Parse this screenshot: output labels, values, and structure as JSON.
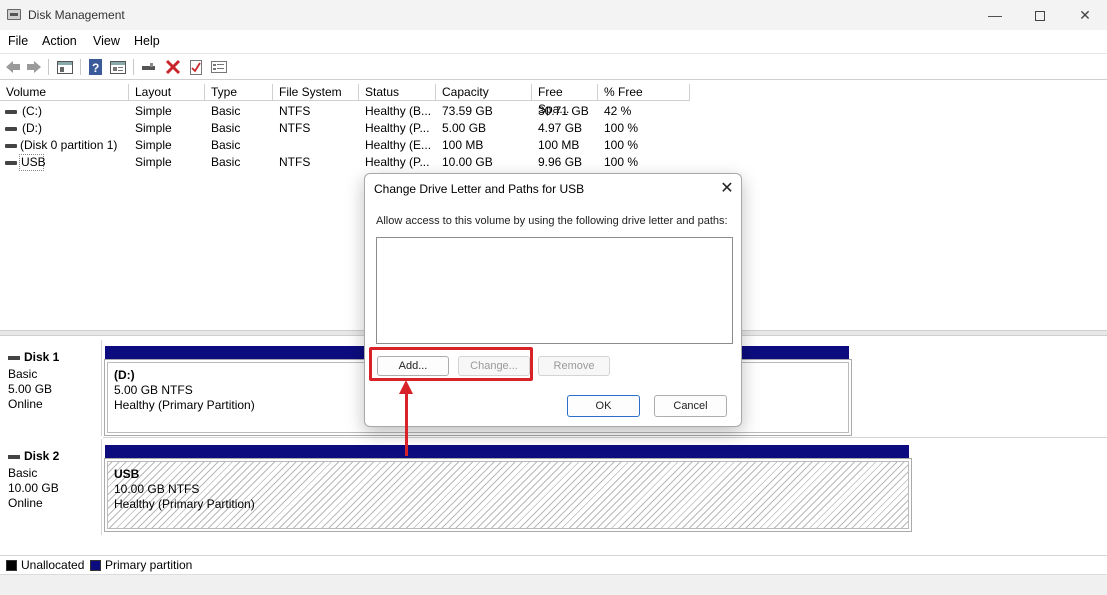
{
  "window": {
    "title": "Disk Management",
    "minimize_glyph": "—",
    "close_glyph": "✕"
  },
  "menu": [
    "File",
    "Action",
    "View",
    "Help"
  ],
  "toolbar_icons": [
    "back-icon",
    "forward-icon",
    "console-tree-icon",
    "help-icon",
    "properties-icon",
    "connect-icon",
    "delete-icon",
    "check-icon",
    "list-icon"
  ],
  "volume_table": {
    "columns": [
      "Volume",
      "Layout",
      "Type",
      "File System",
      "Status",
      "Capacity",
      "Free Spa...",
      "% Free"
    ],
    "rows": [
      {
        "volume": "(C:)",
        "layout": "Simple",
        "type": "Basic",
        "fs": "NTFS",
        "status": "Healthy (B...",
        "capacity": "73.59 GB",
        "free": "30.71 GB",
        "pct": "42 %"
      },
      {
        "volume": "(D:)",
        "layout": "Simple",
        "type": "Basic",
        "fs": "NTFS",
        "status": "Healthy (P...",
        "capacity": "5.00 GB",
        "free": "4.97 GB",
        "pct": "100 %"
      },
      {
        "volume": "(Disk 0 partition 1)",
        "layout": "Simple",
        "type": "Basic",
        "fs": "",
        "status": "Healthy (E...",
        "capacity": "100 MB",
        "free": "100 MB",
        "pct": "100 %"
      },
      {
        "volume": "USB",
        "layout": "Simple",
        "type": "Basic",
        "fs": "NTFS",
        "status": "Healthy (P...",
        "capacity": "10.00 GB",
        "free": "9.96 GB",
        "pct": "100 %"
      }
    ]
  },
  "disks": [
    {
      "name": "Disk 1",
      "type": "Basic",
      "size": "5.00 GB",
      "state": "Online",
      "partition": {
        "label": "(D:)",
        "size_fs": "5.00 GB NTFS",
        "status": "Healthy (Primary Partition)"
      }
    },
    {
      "name": "Disk 2",
      "type": "Basic",
      "size": "10.00 GB",
      "state": "Online",
      "partition": {
        "label": "USB",
        "size_fs": "10.00 GB NTFS",
        "status": "Healthy (Primary Partition)"
      }
    }
  ],
  "legend": {
    "unallocated": "Unallocated",
    "primary": "Primary partition",
    "colors": {
      "unallocated": "#000000",
      "primary": "#0c0c7f"
    }
  },
  "dialog": {
    "title": "Change Drive Letter and Paths for USB",
    "close_glyph": "✕",
    "description": "Allow access to this volume by using the following drive letter and paths:",
    "buttons": {
      "add": "Add...",
      "change": "Change...",
      "remove": "Remove",
      "ok": "OK",
      "cancel": "Cancel"
    }
  },
  "annotation_color": "#d8222a"
}
